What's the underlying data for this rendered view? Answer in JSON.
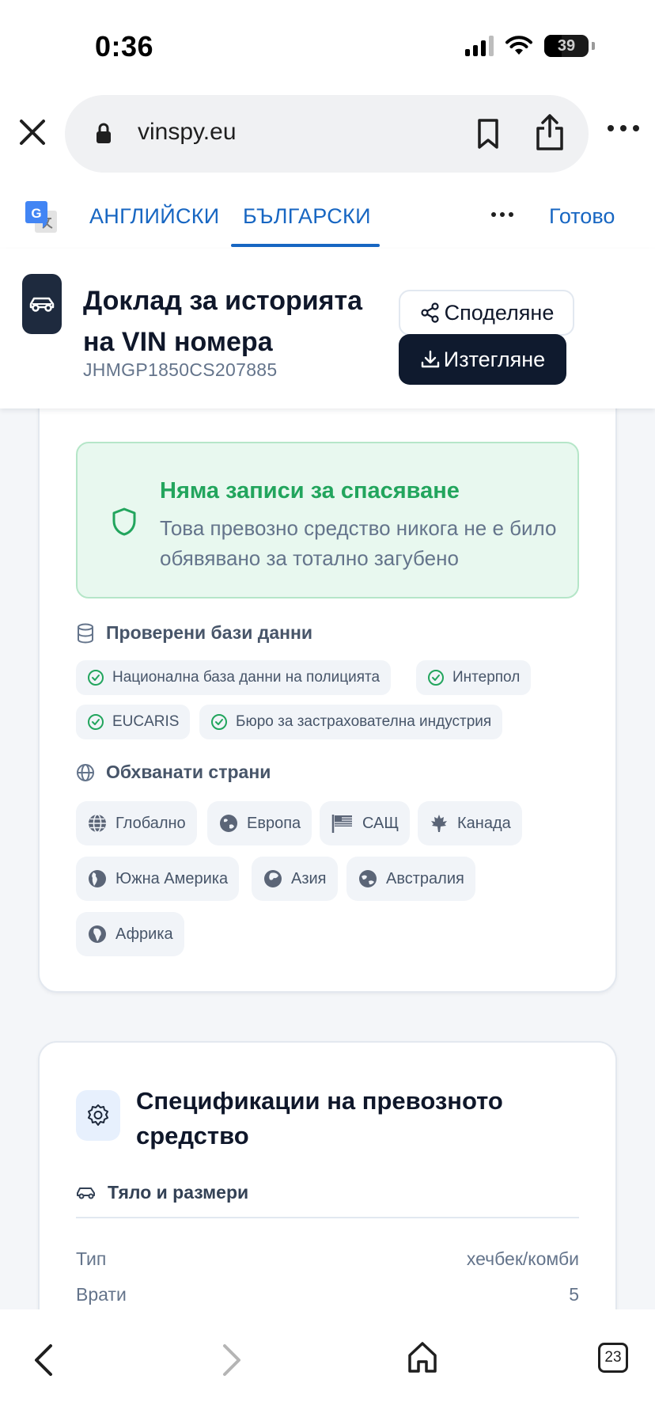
{
  "status_bar": {
    "time": "0:36",
    "battery_level": "39"
  },
  "browser": {
    "url": "vinspy.eu"
  },
  "translate_bar": {
    "source_lang": "АНГЛИЙСКИ",
    "target_lang": "БЪЛГАРСКИ",
    "done": "Готово"
  },
  "header": {
    "title": "Доклад за историята на VIN номера",
    "vin": "JHMGP1850CS207885",
    "share_label": "Споделяне",
    "download_label": "Изтегляне"
  },
  "salvage": {
    "title": "Няма записи за спасяване",
    "description": "Това превозно средство никога не е било обявявано за тотално загубено"
  },
  "databases": {
    "heading": "Проверени бази данни",
    "items": [
      "Национална база данни на полицията",
      "Интерпол",
      "EUCARIS",
      "Бюро за застрахователна индустрия"
    ]
  },
  "countries": {
    "heading": "Обхванати страни",
    "items": [
      "Глобално",
      "Европа",
      "САЩ",
      "Канада",
      "Южна Америка",
      "Азия",
      "Австралия",
      "Африка"
    ]
  },
  "specs": {
    "title": "Спецификации на превозното средство",
    "subsection": "Тяло и размери",
    "rows": [
      {
        "label": "Тип",
        "value": "хечбек/комби"
      },
      {
        "label": "Врати",
        "value": "5"
      }
    ]
  },
  "bottom_nav": {
    "tab_count": "23"
  },
  "colors": {
    "accent_blue": "#1766c2",
    "success_green": "#22a55d",
    "navy": "#0f1a2e"
  }
}
